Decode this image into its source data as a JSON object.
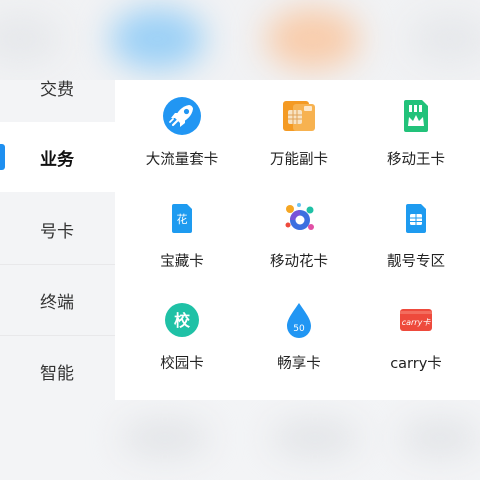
{
  "sidebar": {
    "items": [
      {
        "label": "交费",
        "active": false
      },
      {
        "label": "业务",
        "active": true
      },
      {
        "label": "号卡",
        "active": false
      },
      {
        "label": "终端",
        "active": false
      },
      {
        "label": "智能",
        "active": false
      }
    ]
  },
  "grid": {
    "items": [
      {
        "label": "大流量套卡",
        "icon": "rocket-icon"
      },
      {
        "label": "万能副卡",
        "icon": "sim-cards-icon"
      },
      {
        "label": "移动王卡",
        "icon": "sim-crown-icon"
      },
      {
        "label": "宝藏卡",
        "icon": "hua-card-icon"
      },
      {
        "label": "移动花卡",
        "icon": "colorful-sim-icon"
      },
      {
        "label": "靓号专区",
        "icon": "sim-chip-icon"
      },
      {
        "label": "校园卡",
        "icon": "xiao-badge-icon",
        "badge_text": "校"
      },
      {
        "label": "畅享卡",
        "icon": "water-drop-icon",
        "badge_text": "50"
      },
      {
        "label": "carry卡",
        "icon": "carry-card-icon",
        "badge_text": "carry卡"
      }
    ],
    "hua_badge": "花"
  },
  "colors": {
    "accent": "#1e8ff0",
    "sidebar_bg": "#f3f4f6",
    "teal": "#1fc1a6",
    "orange": "#f49a23",
    "green": "#22c27a",
    "red": "#ee4a3c"
  }
}
